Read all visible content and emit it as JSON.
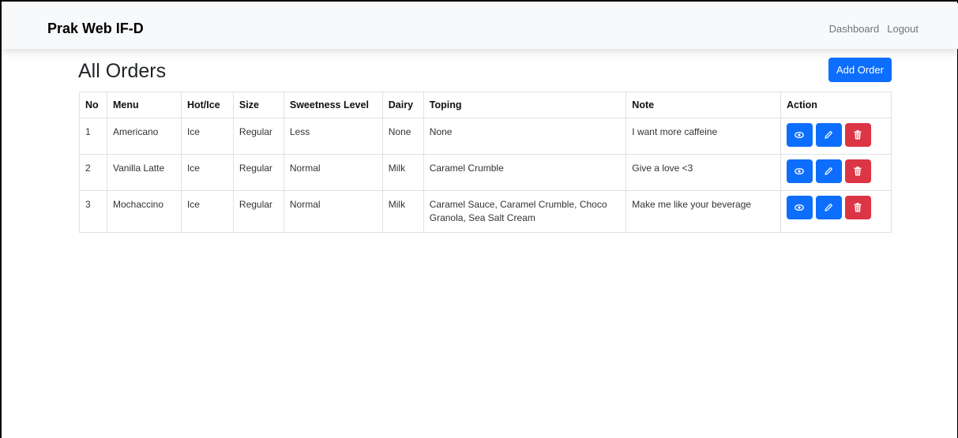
{
  "navbar": {
    "brand": "Prak Web IF-D",
    "links": [
      "Dashboard",
      "Logout"
    ]
  },
  "page": {
    "title": "All Orders",
    "add_label": "Add Order"
  },
  "table": {
    "headers": [
      "No",
      "Menu",
      "Hot/Ice",
      "Size",
      "Sweetness Level",
      "Dairy",
      "Toping",
      "Note",
      "Action"
    ],
    "rows": [
      {
        "no": "1",
        "menu": "Americano",
        "hot_ice": "Ice",
        "size": "Regular",
        "sweetness": "Less",
        "dairy": "None",
        "toping": "None",
        "note": "I want more caffeine"
      },
      {
        "no": "2",
        "menu": "Vanilla Latte",
        "hot_ice": "Ice",
        "size": "Regular",
        "sweetness": "Normal",
        "dairy": "Milk",
        "toping": "Caramel Crumble",
        "note": "Give a love <3"
      },
      {
        "no": "3",
        "menu": "Mochaccino",
        "hot_ice": "Ice",
        "size": "Regular",
        "sweetness": "Normal",
        "dairy": "Milk",
        "toping": "Caramel Sauce, Caramel Crumble, Choco Granola, Sea Salt Cream",
        "note": "Make me like your beverage"
      }
    ],
    "action_icons": [
      "eye-icon",
      "pencil-icon",
      "trash-icon"
    ]
  },
  "colors": {
    "primary": "#0d6efd",
    "danger": "#dc3545",
    "navbar_bg": "#f8f9fa"
  }
}
